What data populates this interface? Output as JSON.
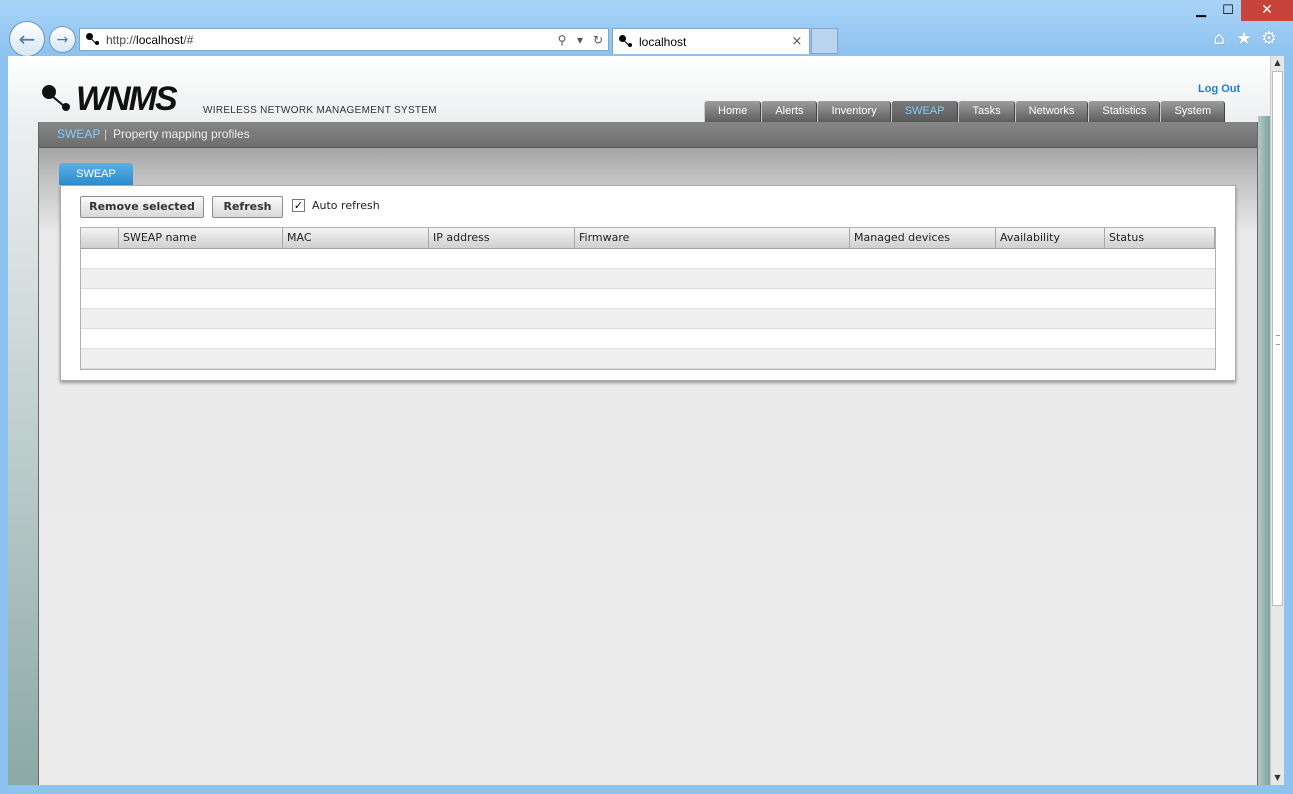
{
  "browser": {
    "url_prefix": "http://",
    "url_host": "localhost",
    "url_suffix": "/#",
    "tab_title": "localhost",
    "tab_close": "×",
    "window_min": "▁",
    "window_max": "☐",
    "window_close": "✕"
  },
  "header": {
    "logo_text": "WNMS",
    "system_title": "WIRELESS NETWORK MANAGEMENT SYSTEM",
    "logout": "Log Out"
  },
  "nav": {
    "tabs": [
      {
        "label": "Home"
      },
      {
        "label": "Alerts"
      },
      {
        "label": "Inventory"
      },
      {
        "label": "SWEAP",
        "active": true
      },
      {
        "label": "Tasks"
      },
      {
        "label": "Networks"
      },
      {
        "label": "Statistics"
      },
      {
        "label": "System"
      }
    ]
  },
  "subnav": {
    "current": "SWEAP",
    "separator": "|",
    "item": "Property mapping profiles"
  },
  "panel": {
    "tab_label": "SWEAP",
    "remove_label": "Remove selected",
    "refresh_label": "Refresh",
    "auto_refresh_label": "Auto refresh",
    "auto_refresh_checked": true
  },
  "grid": {
    "columns": [
      "",
      "SWEAP name",
      "MAC",
      "IP address",
      "Firmware",
      "Managed devices",
      "Availability",
      "Status"
    ],
    "rows": []
  },
  "colors": {
    "accent": "#2d8ccd",
    "active_tab_text": "#7fd0ff",
    "logout": "#1a7fcf"
  }
}
